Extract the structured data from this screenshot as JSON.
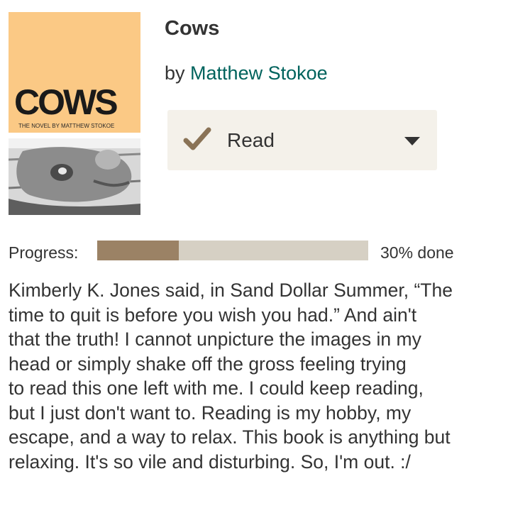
{
  "book": {
    "title": "Cows",
    "by_label": "by",
    "author": "Matthew Stokoe",
    "cover": {
      "title": "COWS",
      "subtitle": "THE NOVEL BY MATTHEW STOKOE"
    }
  },
  "shelf": {
    "status": "Read",
    "check_icon": "check-icon",
    "dropdown_icon": "caret-down-icon"
  },
  "progress": {
    "label": "Progress:",
    "percent": 30,
    "text": "30% done"
  },
  "review": {
    "lines": [
      "Kimberly K. Jones said, in Sand Dollar Summer, “The",
      "time to quit is before you wish you had.” And ain't",
      "that the truth! I cannot unpicture the images in my",
      "head or simply shake off the gross feeling trying",
      "to read this one left with me. I could keep reading,",
      "but I just don't want to. Reading is my hobby, my",
      "escape, and a way to relax. This book is anything but",
      "relaxing. It's so vile and disturbing. So, I'm out. :/"
    ]
  },
  "colors": {
    "cover_orange": "#fbc985",
    "author_link": "#00635d",
    "shelf_bg": "#f4f1ea",
    "check": "#8a7356",
    "progress_fill": "#9b8265",
    "progress_track": "#d6d0c4"
  }
}
